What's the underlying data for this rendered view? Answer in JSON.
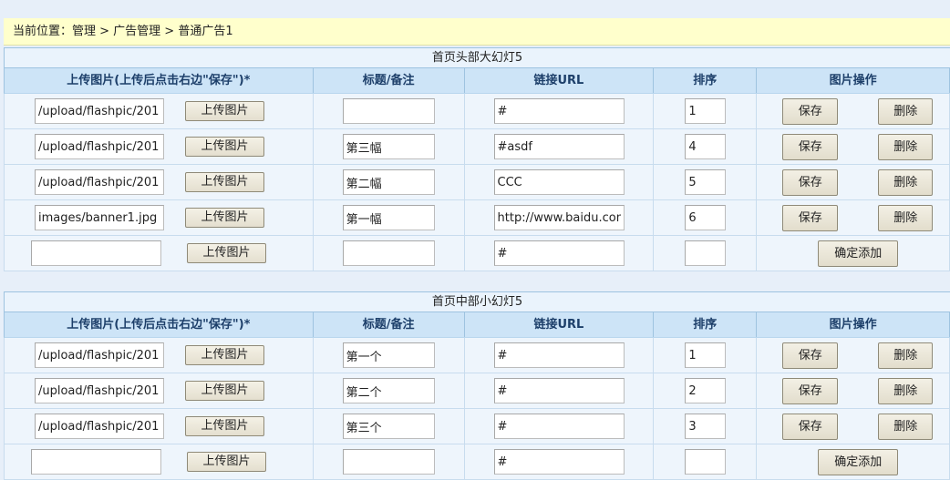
{
  "breadcrumb": "当前位置：管理 > 广告管理 > 普通广告1",
  "headers": {
    "image": "上传图片(上传后点击右边\"保存\")*",
    "title": "标题/备注",
    "url": "链接URL",
    "order": "排序",
    "ops": "图片操作"
  },
  "labels": {
    "upload": "上传图片",
    "save": "保存",
    "delete": "删除",
    "add": "确定添加"
  },
  "sections": [
    {
      "title": "首页头部大幻灯5",
      "rows": [
        {
          "image": "/upload/flashpic/201",
          "title": "",
          "url": "#",
          "order": "1"
        },
        {
          "image": "/upload/flashpic/201",
          "title": "第三幅",
          "url": "#asdf",
          "order": "4"
        },
        {
          "image": "/upload/flashpic/201",
          "title": "第二幅",
          "url": "CCC",
          "order": "5"
        },
        {
          "image": "images/banner1.jpg",
          "title": "第一幅",
          "url": "http://www.baidu.com",
          "order": "6"
        }
      ],
      "new_row": {
        "image": "",
        "title": "",
        "url": "#",
        "order": ""
      }
    },
    {
      "title": "首页中部小幻灯5",
      "rows": [
        {
          "image": "/upload/flashpic/201",
          "title": "第一个",
          "url": "#",
          "order": "1"
        },
        {
          "image": "/upload/flashpic/201",
          "title": "第二个",
          "url": "#",
          "order": "2"
        },
        {
          "image": "/upload/flashpic/201",
          "title": "第三个",
          "url": "#",
          "order": "3"
        }
      ],
      "new_row": {
        "image": "",
        "title": "",
        "url": "#",
        "order": ""
      }
    }
  ]
}
